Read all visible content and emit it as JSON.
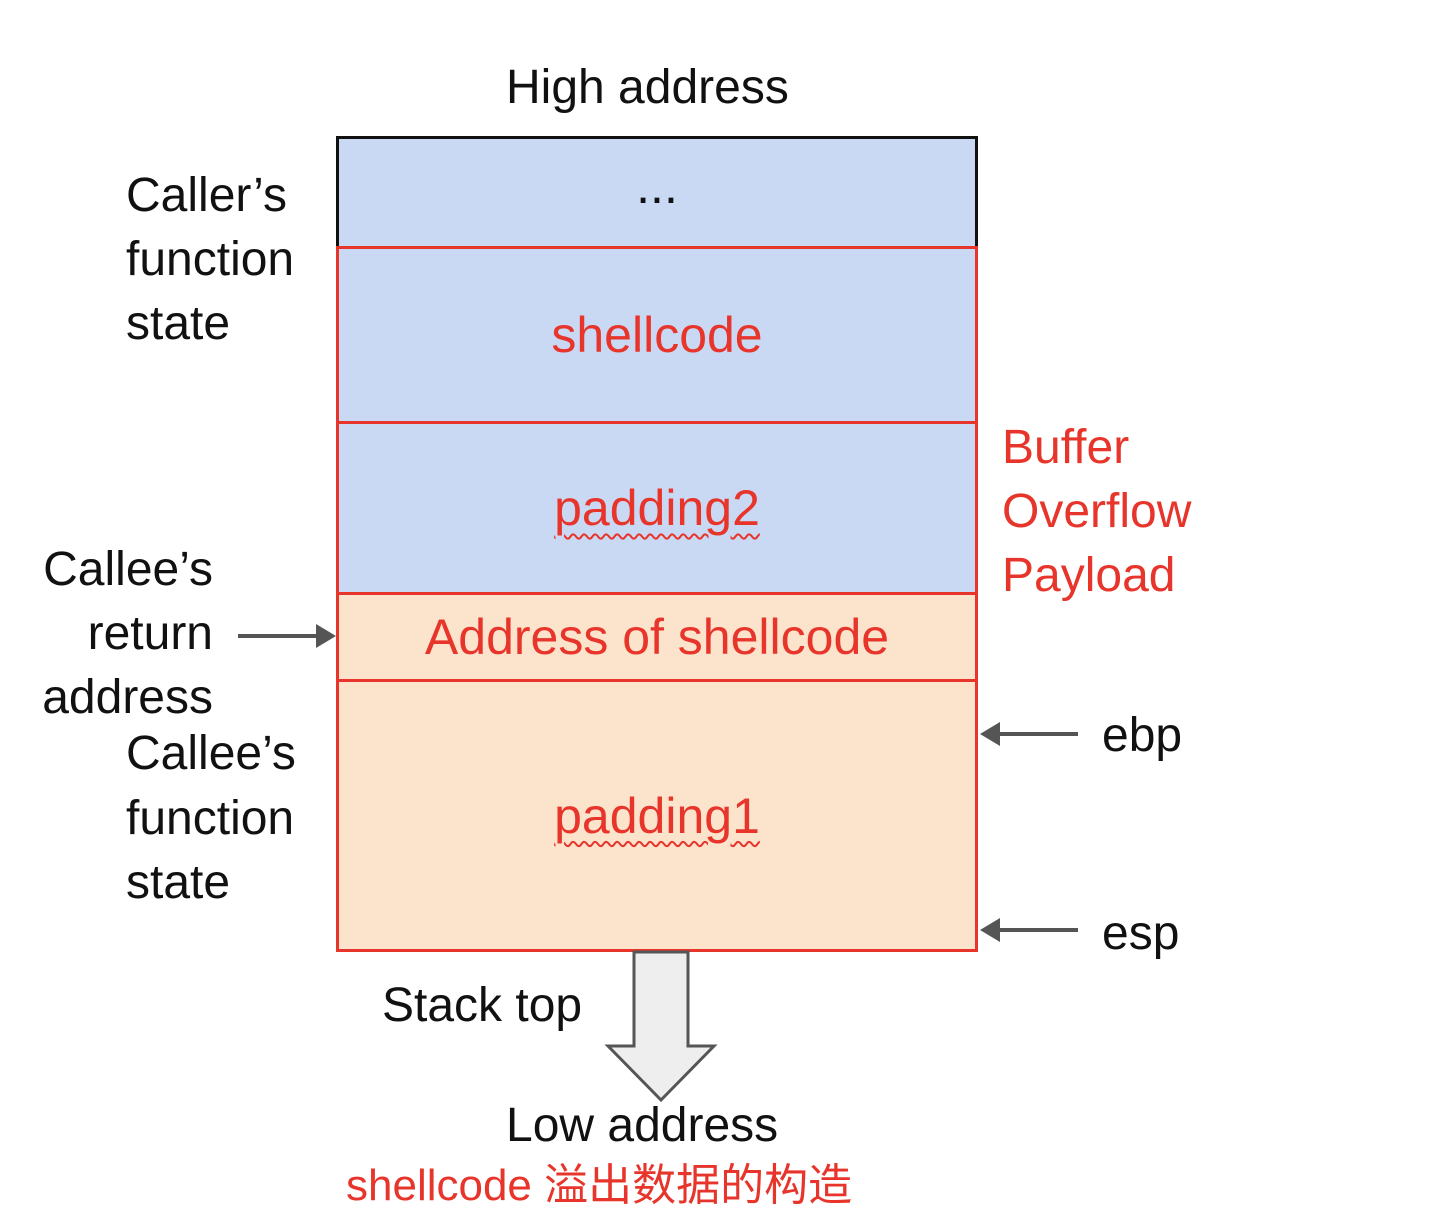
{
  "header": {
    "high_address": "High address"
  },
  "stack": {
    "top_block": "...",
    "shellcode": "shellcode",
    "padding2": "padding2",
    "return_addr": "Address of shellcode",
    "padding1": "padding1"
  },
  "left_labels": {
    "caller_state": [
      "Caller’s",
      "function",
      "state"
    ],
    "callee_return": [
      "Callee’s",
      "return",
      "address"
    ],
    "callee_state": [
      "Callee’s",
      "function",
      "state"
    ]
  },
  "right_labels": {
    "payload": [
      "Buffer",
      "Overflow",
      "Payload"
    ],
    "ebp": "ebp",
    "esp": "esp"
  },
  "footer": {
    "stack_top": "Stack top",
    "low_address": "Low address",
    "caption": "shellcode 溢出数据的构造"
  },
  "colors": {
    "blue_fill": "#c9d9f4",
    "peach_fill": "#fce4cc",
    "red": "#e8352b",
    "arrow_gray": "#555555"
  }
}
